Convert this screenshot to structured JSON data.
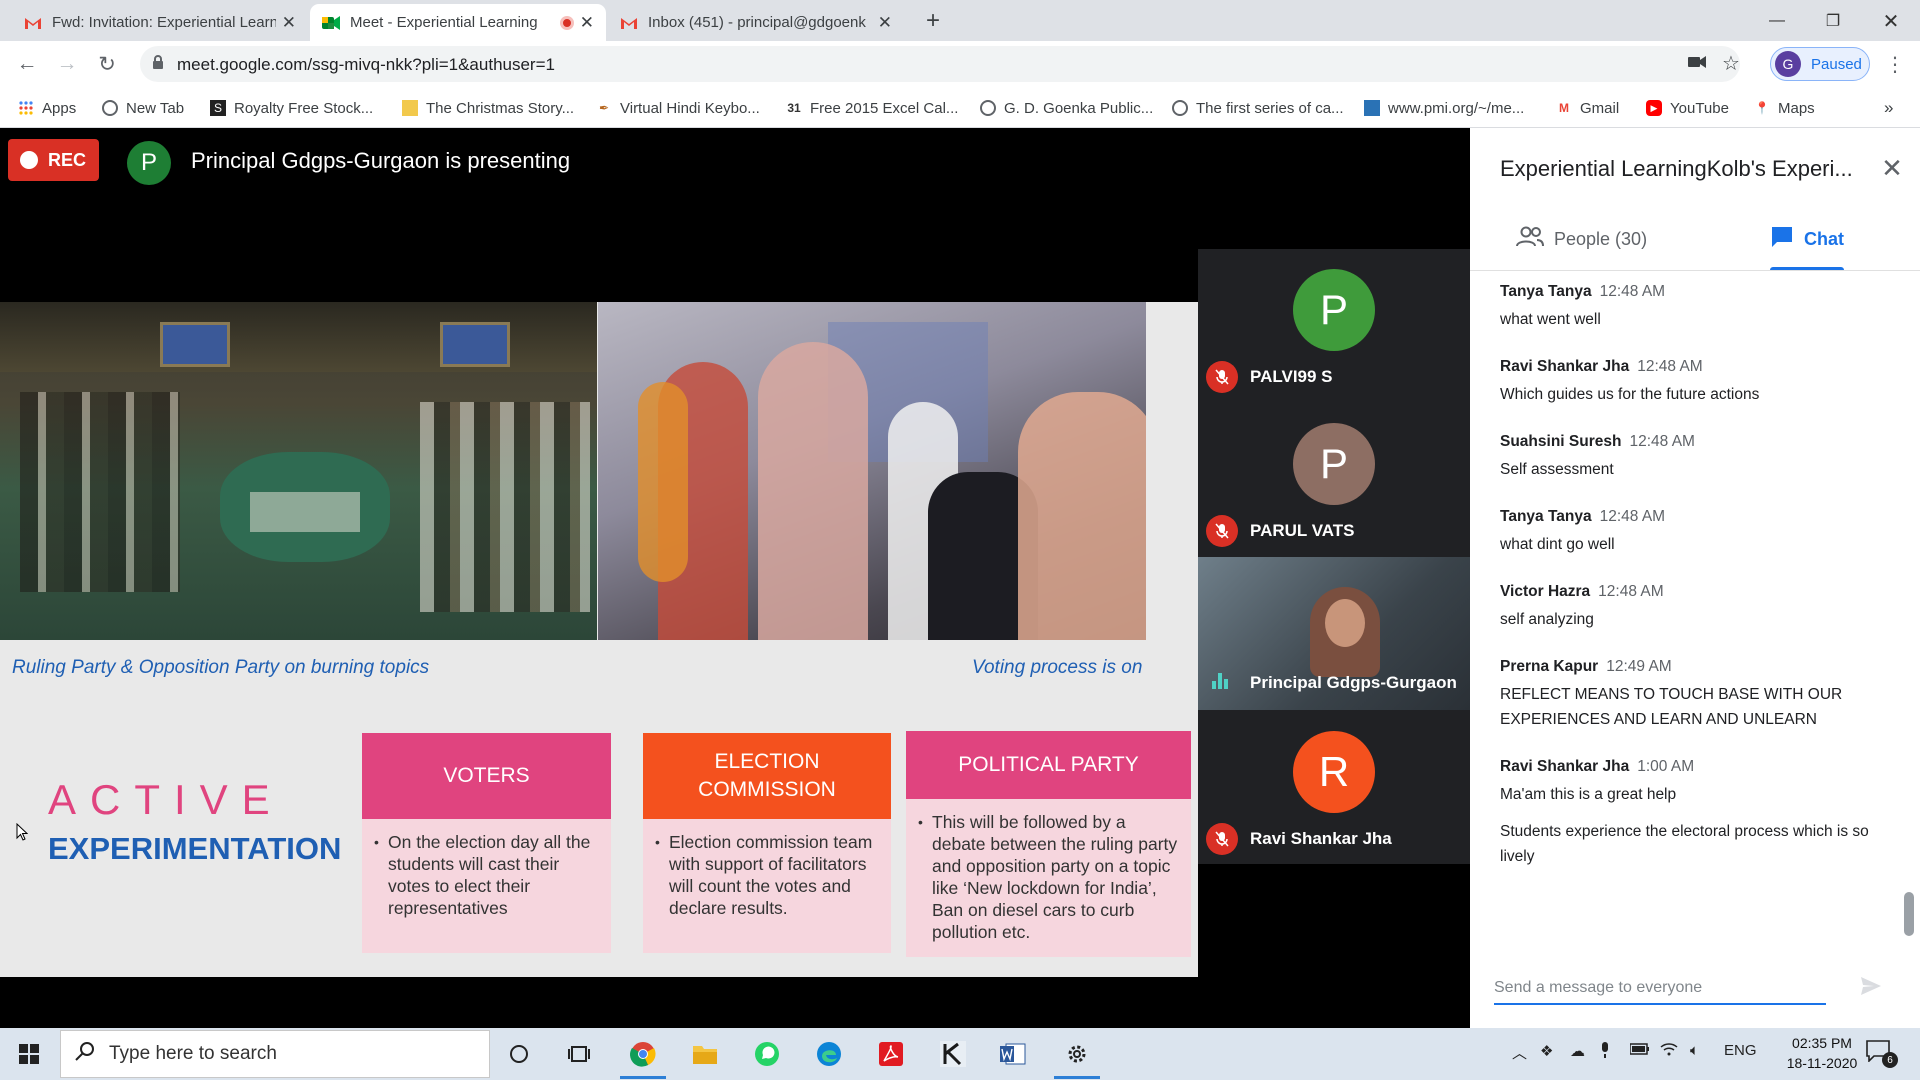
{
  "browser": {
    "tabs": [
      {
        "title": "Fwd: Invitation: Experiential Learn",
        "active": false
      },
      {
        "title": "Meet - Experiential Learning",
        "active": true
      },
      {
        "title": "Inbox (451) - principal@gdgoenk",
        "active": false
      }
    ],
    "new_tab": "+",
    "url": "meet.google.com/ssg-mivq-nkk?pli=1&authuser=1",
    "profile_initial": "G",
    "profile_status": "Paused",
    "bookmarks": [
      "Apps",
      "New Tab",
      "Royalty Free Stock...",
      "The Christmas Story...",
      "Virtual Hindi Keybo...",
      "Free 2015 Excel Cal...",
      "G. D. Goenka Public...",
      "The first series of ca...",
      "www.pmi.org/~/me...",
      "Gmail",
      "YouTube",
      "Maps"
    ],
    "bookmarks_more": "»"
  },
  "meet": {
    "rec_label": "REC",
    "presenter_initial": "P",
    "presenting_text": "Principal Gdgps-Gurgaon is presenting",
    "slide": {
      "caption_left": "Ruling Party & Opposition Party on burning topics",
      "caption_right": "Voting process is on",
      "heading_line1": "ACTIVE",
      "heading_line2": "EXPERIMENTATION",
      "boxes": [
        {
          "title": "VOTERS",
          "body": "On the  election day all the students will cast their votes to elect their representatives"
        },
        {
          "title": "ELECTION COMMISSION",
          "body": "Election commission team with support of facilitators will count the votes and declare results."
        },
        {
          "title": "POLITICAL PARTY",
          "body": "This will be followed by a debate between the ruling party and opposition party on a topic like ‘New lockdown for India’, Ban on diesel cars to curb pollution etc."
        }
      ]
    },
    "participants": [
      {
        "initial": "P",
        "name": "PALVI99 S",
        "color": "#3f9b3b"
      },
      {
        "initial": "P",
        "name": "PARUL VATS",
        "color": "#8d6e63"
      },
      {
        "initial": "",
        "name": "Principal Gdgps-Gurgaon",
        "color": "#5a6b78"
      },
      {
        "initial": "R",
        "name": "Ravi Shankar Jha",
        "color": "#f4511e"
      }
    ]
  },
  "panel": {
    "title": "Experiential LearningKolb's Experi...",
    "tab_people": "People (30)",
    "tab_chat": "Chat",
    "messages": [
      {
        "sender": "Tanya Tanya",
        "time": "12:48 AM",
        "texts": [
          "what went well"
        ]
      },
      {
        "sender": "Ravi Shankar Jha",
        "time": "12:48 AM",
        "texts": [
          "Which guides us for the future actions"
        ]
      },
      {
        "sender": "Suahsini Suresh",
        "time": "12:48 AM",
        "texts": [
          "Self assessment"
        ]
      },
      {
        "sender": "Tanya Tanya",
        "time": "12:48 AM",
        "texts": [
          "what dint go well"
        ]
      },
      {
        "sender": "Victor Hazra",
        "time": "12:48 AM",
        "texts": [
          "self analyzing"
        ]
      },
      {
        "sender": "Prerna Kapur",
        "time": "12:49 AM",
        "texts": [
          "REFLECT MEANS TO TOUCH BASE WITH OUR EXPERIENCES AND LEARN AND UNLEARN"
        ]
      },
      {
        "sender": "Ravi Shankar Jha",
        "time": "1:00 AM",
        "texts": [
          "Ma'am this is a great help",
          "Students experience the  electoral process which is so lively"
        ]
      }
    ],
    "input_placeholder": "Send a message to everyone"
  },
  "taskbar": {
    "search_placeholder": "Type here to search",
    "language": "ENG",
    "time": "02:35 PM",
    "date": "18-11-2020",
    "notification_count": "6"
  },
  "colors": {
    "accent": "#1a73e8",
    "rec": "#d93025",
    "pink": "#e0447f",
    "slide_blue": "#1f5fb3"
  }
}
